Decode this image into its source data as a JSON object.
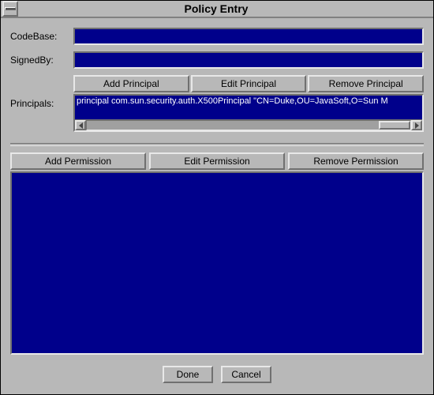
{
  "window": {
    "title": "Policy Entry"
  },
  "labels": {
    "codebase": "CodeBase:",
    "signedby": "SignedBy:",
    "principals": "Principals:"
  },
  "fields": {
    "codebase": "",
    "signedby": ""
  },
  "principalButtons": {
    "add": "Add Principal",
    "edit": "Edit Principal",
    "remove": "Remove Principal"
  },
  "principalList": {
    "items": [
      "principal com.sun.security.auth.X500Principal \"CN=Duke,OU=JavaSoft,O=Sun M"
    ]
  },
  "permissionButtons": {
    "add": "Add Permission",
    "edit": "Edit Permission",
    "remove": "Remove Permission"
  },
  "actions": {
    "done": "Done",
    "cancel": "Cancel"
  },
  "colors": {
    "windowBg": "#b8b8b8",
    "inputBg": "#00008b"
  }
}
